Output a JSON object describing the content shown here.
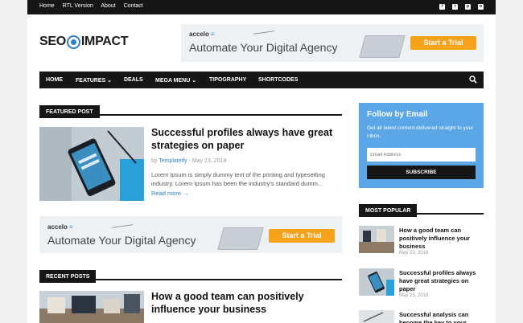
{
  "topbar": {
    "links": [
      "Home",
      "RTL Version",
      "About",
      "Contact"
    ],
    "social": [
      "facebook-icon",
      "twitter-icon",
      "pinterest-icon",
      "instagram-icon"
    ],
    "social_glyphs": [
      "f",
      "t",
      "p",
      "o"
    ]
  },
  "logo": {
    "left": "SEO",
    "right": "IMPACT"
  },
  "ad": {
    "brand": "accelo",
    "brand_mark": "≡",
    "headline": "Automate Your Digital Agency",
    "cta": "Start a Trial"
  },
  "nav": {
    "items": [
      "HOME",
      "FEATURES ⌄",
      "DEALS",
      "MEGA MENU ⌄",
      "TIPOGRAPHY",
      "SHORTCODES"
    ]
  },
  "featured": {
    "section_label": "FEATURED POST",
    "title": "Successful profiles always have great strategies on paper",
    "meta_prefix": "by",
    "author": "Templateify",
    "date": "- May 23, 2018",
    "excerpt": "Lorem Ipsum is simply dummy text of the printing and typesetting industry. Lorem Ipsum has been the industry's standard dumm...",
    "read_more": "Read more →"
  },
  "recent": {
    "section_label": "RECENT POSTS",
    "title": "How a good team can positively influence your business"
  },
  "follow": {
    "title": "Follow by Email",
    "text": "Get all latest content delivered straight to your inbox.",
    "placeholder": "Email Address",
    "button": "SUBSCRIBE"
  },
  "popular": {
    "section_label": "MOST POPULAR",
    "items": [
      {
        "title": "How a good team can positively influence your business",
        "date": "May 23, 2018"
      },
      {
        "title": "Successful profiles always have great strategies on paper",
        "date": "May 23, 2018"
      },
      {
        "title": "Successful analysis can become the key to your",
        "date": ""
      }
    ]
  },
  "colors": {
    "accent": "#2f7fc7",
    "dark": "#161616",
    "cta": "#f7a21b",
    "follow_bg": "#5aa6e6"
  }
}
